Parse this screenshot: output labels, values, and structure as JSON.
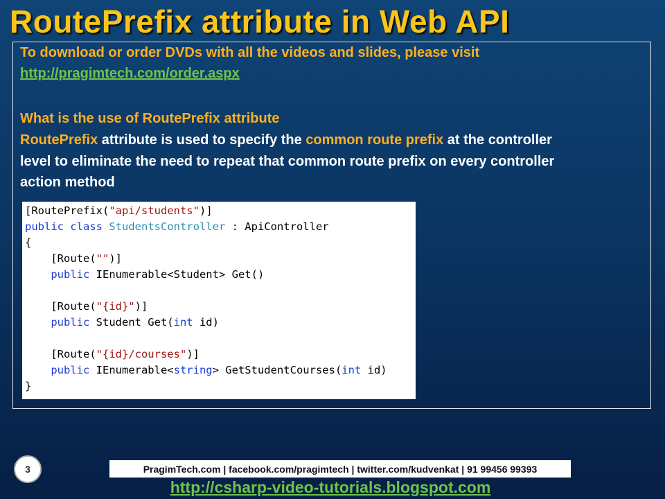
{
  "title": "RoutePrefix attribute in Web API",
  "intro": {
    "text": "To download or order DVDs with all the videos and slides, please visit",
    "link": "http://pragimtech.com/order.aspx"
  },
  "section": {
    "heading": "What is the use of RoutePrefix attribute",
    "p_line1": {
      "a": "RoutePrefix",
      "b": " attribute is used to specify the ",
      "c": "common route prefix",
      "d": " at the controller"
    },
    "p_line2": "level to eliminate the need to repeat that common route prefix on every controller",
    "p_line3": "action method"
  },
  "code": {
    "l1": {
      "a": "[RoutePrefix(",
      "b": "\"api/students\"",
      "c": ")]"
    },
    "l2": {
      "a": "public class ",
      "b": "StudentsController",
      "c": " : ApiController"
    },
    "l3": "{",
    "l4": {
      "a": "    [Route(",
      "b": "\"\"",
      "c": ")]"
    },
    "l5": {
      "a": "    public ",
      "b": "IEnumerable<Student> Get()"
    },
    "l6": {
      "a": "    [Route(",
      "b": "\"{id}\"",
      "c": ")]"
    },
    "l7": {
      "a": "    public ",
      "b": "Student Get(",
      "c": "int",
      "d": " id)"
    },
    "l8": {
      "a": "    [Route(",
      "b": "\"{id}/courses\"",
      "c": ")]"
    },
    "l9": {
      "a": "    public ",
      "b": "IEnumerable<",
      "c": "string",
      "d": "> GetStudentCourses(",
      "e": "int",
      "f": " id)"
    },
    "l10": "}"
  },
  "slide_number": "3",
  "footer": {
    "bar": "PragimTech.com | facebook.com/pragimtech  | twitter.com/kudvenkat  | 91 99456 99393",
    "link": "http://csharp-video-tutorials.blogspot.com"
  }
}
